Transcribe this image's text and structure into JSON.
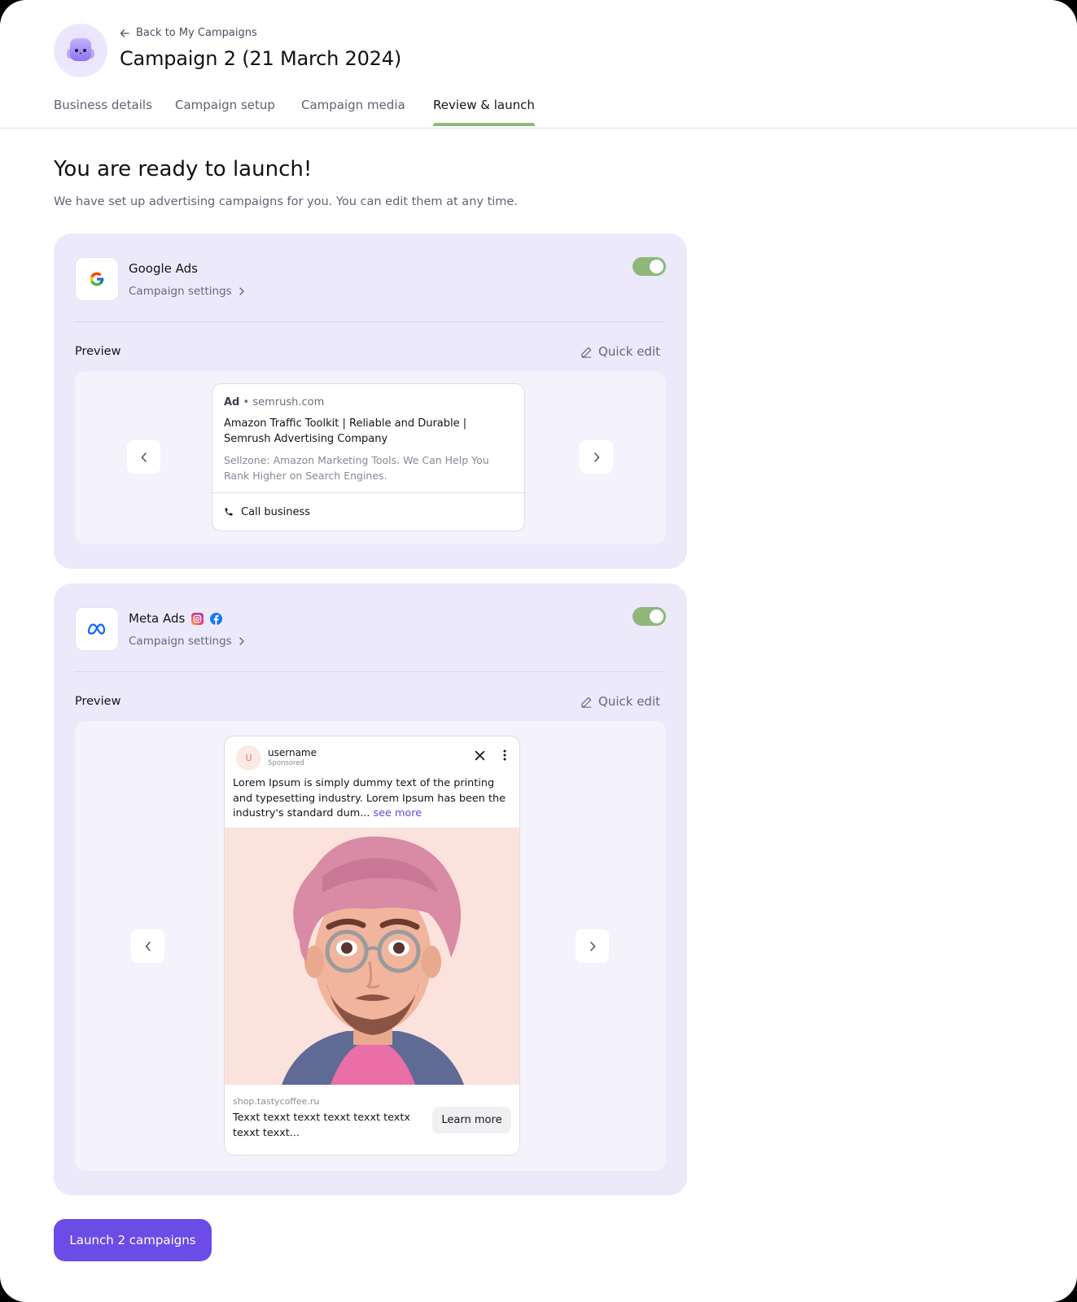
{
  "header": {
    "back_label": "Back to My Campaigns",
    "title": "Campaign 2 (21 March 2024)"
  },
  "tabs": [
    {
      "label": "Business details",
      "active": false
    },
    {
      "label": "Campaign setup",
      "active": false
    },
    {
      "label": "Campaign media",
      "active": false
    },
    {
      "label": "Review & launch",
      "active": true
    }
  ],
  "main": {
    "heading": "You are ready to launch!",
    "subheading": "We have set up advertising campaigns for you. You can edit them at any time."
  },
  "channels": [
    {
      "name": "Google Ads",
      "settings_label": "Campaign settings",
      "enabled": true,
      "preview_label": "Preview",
      "quick_edit_label": "Quick edit",
      "ad": {
        "ad_tag": "Ad",
        "separator": "•",
        "domain": "semrush.com",
        "headline": "Amazon Traffic Toolkit | Reliable and Durable | Semrush Advertising Company",
        "description": "Sellzone: Amazon Marketing Tools. We Can Help You Rank Higher on Search Engines.",
        "cta": "Call business"
      }
    },
    {
      "name": "Meta Ads",
      "platform_icons": [
        "instagram-icon",
        "facebook-icon"
      ],
      "settings_label": "Campaign settings",
      "enabled": true,
      "preview_label": "Preview",
      "quick_edit_label": "Quick edit",
      "ad": {
        "avatar_initial": "U",
        "username": "username",
        "sponsored": "Sponsored",
        "body": "Lorem Ipsum is simply dummy text of the printing and typesetting industry. Lorem Ipsum has been the industry's standard dum...",
        "see_more": "see more",
        "domain": "shop.tastycoffee.ru",
        "caption": "Texxt texxt texxt texxt texxt textx texxt texxt...",
        "cta": "Learn more"
      }
    }
  ],
  "launch_button": "Launch 2 campaigns",
  "colors": {
    "accent": "#6b4ce6",
    "toggle_on": "#8fb77a",
    "card_bg": "#ece9fb",
    "tab_indicator": "#8fb77a"
  }
}
